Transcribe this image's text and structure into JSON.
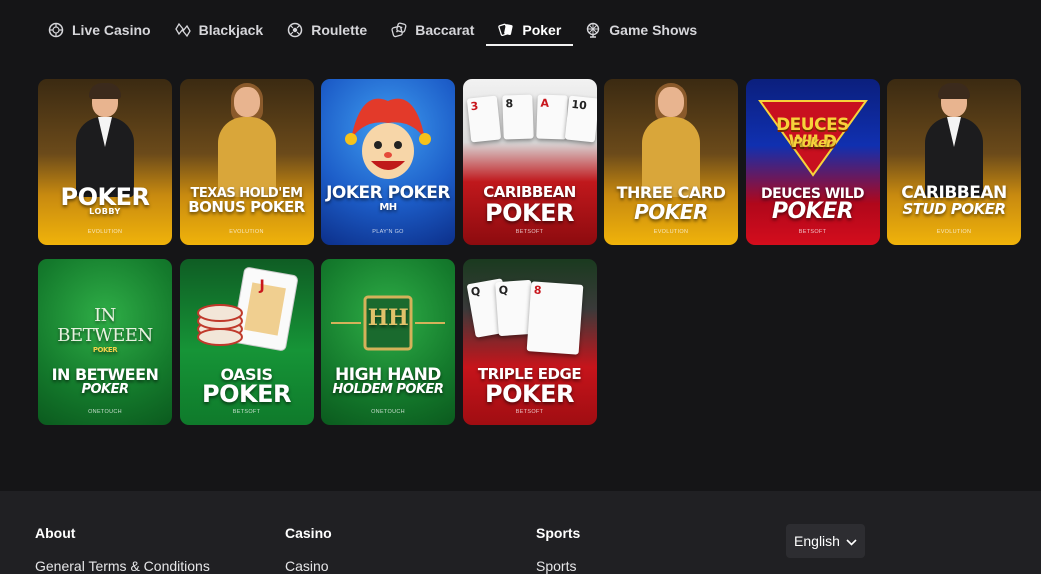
{
  "tabs": [
    {
      "label": "Live Casino",
      "icon": "chip-icon",
      "active": false
    },
    {
      "label": "Blackjack",
      "icon": "cards-icon",
      "active": false
    },
    {
      "label": "Roulette",
      "icon": "roulette-icon",
      "active": false
    },
    {
      "label": "Baccarat",
      "icon": "dice-icon",
      "active": false
    },
    {
      "label": "Poker",
      "icon": "poker-cards-icon",
      "active": true
    },
    {
      "label": "Game Shows",
      "icon": "wheel-icon",
      "active": false
    }
  ],
  "games": [
    {
      "line1": "POKER",
      "line2": "LOBBY",
      "provider": "EVOLUTION",
      "theme": "gold",
      "art": "dealer-male"
    },
    {
      "line1": "TEXAS HOLD'EM",
      "line2": "BONUS POKER",
      "provider": "EVOLUTION",
      "theme": "gold",
      "art": "dealer-female"
    },
    {
      "line1": "JOKER POKER",
      "line2": "MH",
      "provider": "PLAY'N GO",
      "theme": "blue",
      "art": "joker"
    },
    {
      "line1": "CARIBBEAN",
      "line2": "POKER",
      "provider": "BETSOFT",
      "theme": "red",
      "art": "cards"
    },
    {
      "line1": "THREE CARD",
      "line2": "POKER",
      "provider": "EVOLUTION",
      "theme": "gold",
      "art": "dealer-female"
    },
    {
      "line1": "DEUCES WILD",
      "line2": "POKER",
      "provider": "BETSOFT",
      "theme": "deuces",
      "art": "deuces-logo",
      "logo_text": "DEUCES WILD",
      "logo_sub": "Poker"
    },
    {
      "line1": "CARIBBEAN",
      "line2": "STUD POKER",
      "provider": "EVOLUTION",
      "theme": "gold",
      "art": "dealer-male"
    },
    {
      "line1": "IN BETWEEN",
      "line2": "POKER",
      "provider": "ONETOUCH",
      "theme": "green",
      "art": "inbetween-logo",
      "logo_a": "IN",
      "logo_b": "BETWEEN",
      "logo_c": "POKER"
    },
    {
      "line1": "OASIS",
      "line2": "POKER",
      "provider": "BETSOFT",
      "theme": "green2",
      "art": "chips-card",
      "card_rank": "J"
    },
    {
      "line1": "HIGH HAND",
      "line2": "HOLDEM POKER",
      "provider": "ONETOUCH",
      "theme": "green",
      "art": "hh-logo",
      "logo_a": "HH"
    },
    {
      "line1": "TRIPLE EDGE",
      "line2": "POKER",
      "provider": "BETSOFT",
      "theme": "red2",
      "art": "three-cards",
      "ranks": [
        "Q",
        "Q",
        "8"
      ]
    }
  ],
  "caribbean_ranks": [
    "3",
    "8",
    "A",
    "10"
  ],
  "footer": {
    "cols": [
      {
        "title": "About",
        "first_link": "General Terms & Conditions"
      },
      {
        "title": "Casino",
        "first_link": "Casino"
      },
      {
        "title": "Sports",
        "first_link": "Sports"
      }
    ],
    "language": "English"
  }
}
